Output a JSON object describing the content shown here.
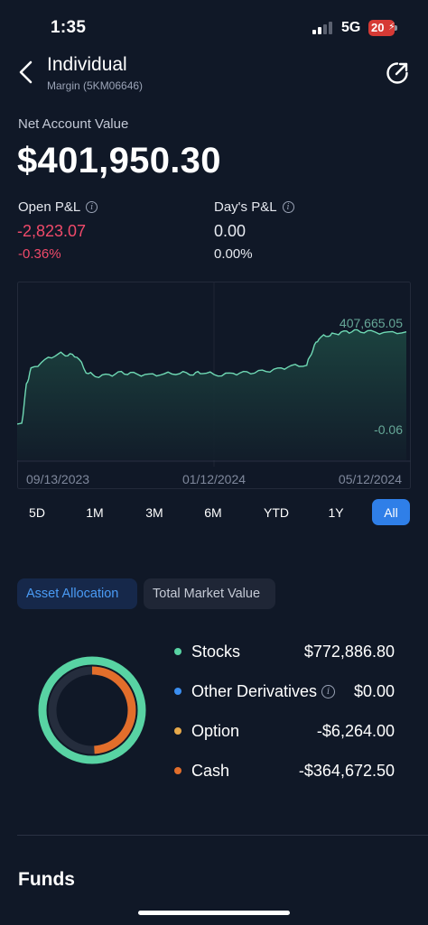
{
  "status_bar": {
    "time": "1:35",
    "network": "5G",
    "battery": "20"
  },
  "header": {
    "title": "Individual",
    "subtitle": "Margin (5KM06646)"
  },
  "account": {
    "net_label": "Net Account Value",
    "net_value": "$401,950.30",
    "open_pl": {
      "label": "Open P&L",
      "value": "-2,823.07",
      "percent": "-0.36%"
    },
    "days_pl": {
      "label": "Day's P&L",
      "value": "0.00",
      "percent": "0.00%"
    }
  },
  "chart_data": {
    "type": "area",
    "series": [
      {
        "x": [
          "2023-09-13",
          "2023-09-16",
          "2023-09-19",
          "2023-09-22",
          "2023-10-01",
          "2023-10-10",
          "2023-10-16",
          "2023-10-22",
          "2023-10-28",
          "2023-11-03",
          "2023-11-12",
          "2023-11-20",
          "2023-11-28",
          "2023-12-08",
          "2023-12-18",
          "2023-12-28",
          "2024-01-06",
          "2024-01-12",
          "2024-01-22",
          "2024-02-01",
          "2024-02-10",
          "2024-02-20",
          "2024-03-01",
          "2024-03-10",
          "2024-03-20",
          "2024-03-24",
          "2024-03-28",
          "2024-04-03",
          "2024-04-08",
          "2024-04-15",
          "2024-04-22",
          "2024-05-01",
          "2024-05-12",
          "2024-05-24"
        ],
        "y": [
          -0.06,
          -0.06,
          170000,
          240000,
          280000,
          310000,
          305000,
          300000,
          230000,
          210000,
          215000,
          225000,
          220000,
          215000,
          220000,
          225000,
          222000,
          228000,
          215000,
          222000,
          225000,
          230000,
          240000,
          255000,
          260000,
          330000,
          380000,
          390000,
          397000,
          405000,
          407665.05,
          404000,
          400000,
          405000
        ]
      }
    ],
    "annotations": [
      "407,665.05",
      "-0.06"
    ],
    "x_ticks": [
      "09/13/2023",
      "01/12/2024",
      "05/12/2024"
    ],
    "fill_color": "#1c4440",
    "line_color": "#6fd9b4"
  },
  "ranges": [
    "5D",
    "1M",
    "3M",
    "6M",
    "YTD",
    "1Y",
    "All"
  ],
  "active_range": "All",
  "tabs": {
    "asset_allocation": "Asset Allocation",
    "total_market_value": "Total Market Value"
  },
  "allocation": [
    {
      "name": "Stocks",
      "value": "$772,886.80",
      "color": "#58d3a3"
    },
    {
      "name": "Other Derivatives",
      "value": "$0.00",
      "color": "#3b8ef0",
      "info": true
    },
    {
      "name": "Option",
      "value": "-$6,264.00",
      "color": "#e7a94a"
    },
    {
      "name": "Cash",
      "value": "-$364,672.50",
      "color": "#e26e2b"
    }
  ],
  "funds_title": "Funds"
}
